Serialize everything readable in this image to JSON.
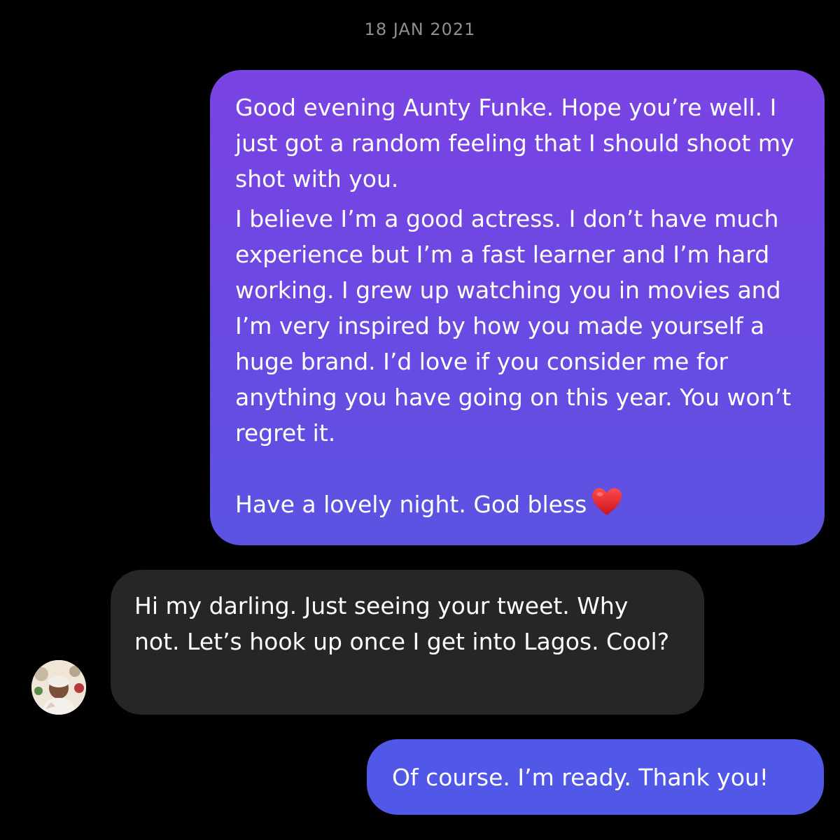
{
  "conversation": {
    "date_header": "18 JAN 2021",
    "messages": [
      {
        "direction": "outgoing",
        "paragraphs": [
          "Good evening Aunty Funke. Hope you’re well. I just got a random feeling that I should shoot my shot with you.",
          "I believe I’m a good actress. I don’t have much experience but I’m a fast learner and I’m hard working. I grew up watching you in movies and I’m very inspired by how you made yourself a huge brand. I’d love if you consider me for anything you have going on this year. You won’t regret it.",
          "Have a lovely night. God bless"
        ],
        "emoji": "heart-icon"
      },
      {
        "direction": "incoming",
        "paragraphs": [
          "Hi my darling. Just seeing your tweet. Why not. Let’s hook up once I get into Lagos. Cool?"
        ],
        "avatar": "avatar"
      },
      {
        "direction": "outgoing",
        "paragraphs": [
          "Of course. I’m ready. Thank you!"
        ]
      }
    ]
  },
  "colors": {
    "background": "#000000",
    "date_text": "#8e8e93",
    "outgoing_gradient_top": "#7a43e3",
    "outgoing_gradient_bottom": "#5b53e2",
    "outgoing_solid": "#5157e6",
    "incoming_bubble": "#262626",
    "heart": "#e0202a"
  }
}
